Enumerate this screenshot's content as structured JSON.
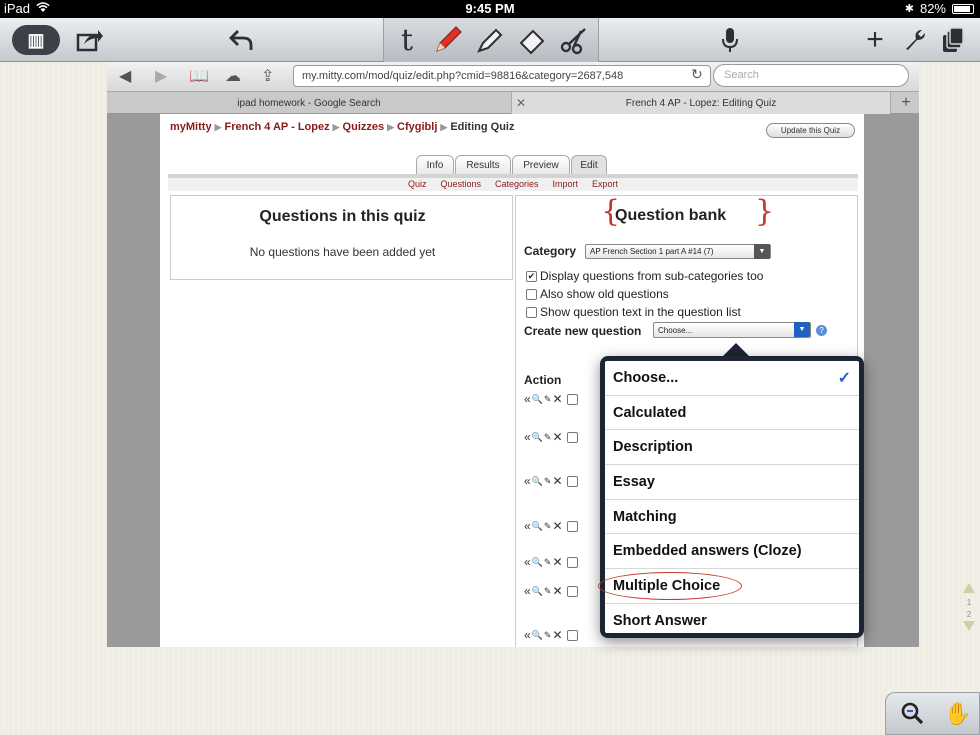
{
  "status": {
    "device": "iPad",
    "time": "9:45 PM",
    "battery": "82%"
  },
  "toolbar": {
    "library_icon": "library-icon",
    "tools": [
      "share-icon",
      "undo-icon",
      "text-tool-icon",
      "pen-tool-icon",
      "highlighter-icon",
      "eraser-icon",
      "scissors-icon",
      "microphone-icon",
      "add-icon",
      "wrench-icon",
      "pages-icon"
    ]
  },
  "browser": {
    "url": "my.mitty.com/mod/quiz/edit.php?cmid=98816&category=2687,548",
    "search_placeholder": "Search",
    "tabs": [
      "ipad homework - Google Search",
      "French 4 AP - Lopez: Editing Quiz"
    ]
  },
  "page": {
    "breadcrumb": [
      "myMitty",
      "French 4 AP - Lopez",
      "Quizzes",
      "Cfygiblj",
      "Editing Quiz"
    ],
    "update_button": "Update this Quiz",
    "tabs": [
      "Info",
      "Results",
      "Preview",
      "Edit"
    ],
    "subnav": [
      "Quiz",
      "Questions",
      "Categories",
      "Import",
      "Export"
    ],
    "quiz_title": "Questions in this quiz",
    "quiz_empty": "No questions have been added yet",
    "bank_title": "Question bank",
    "category_label": "Category",
    "category_value": "AP French Section 1 part A #14 (7)",
    "options": [
      {
        "label": "Display questions from sub-categories too",
        "checked": true
      },
      {
        "label": "Also show old questions",
        "checked": false
      },
      {
        "label": "Show question text in the question list",
        "checked": false
      }
    ],
    "create_label": "Create new question",
    "create_value": "Choose...",
    "action_label": "Action"
  },
  "dropdown": {
    "items": [
      "Choose...",
      "Calculated",
      "Description",
      "Essay",
      "Matching",
      "Embedded answers (Cloze)",
      "Multiple Choice",
      "Short Answer"
    ],
    "selected": "Choose..."
  },
  "page_indicator": {
    "current": "1",
    "total": "2"
  },
  "colors": {
    "accent_red": "#8b1a1a",
    "annotation_red": "#c0392b",
    "check_blue": "#2a5bd7"
  }
}
